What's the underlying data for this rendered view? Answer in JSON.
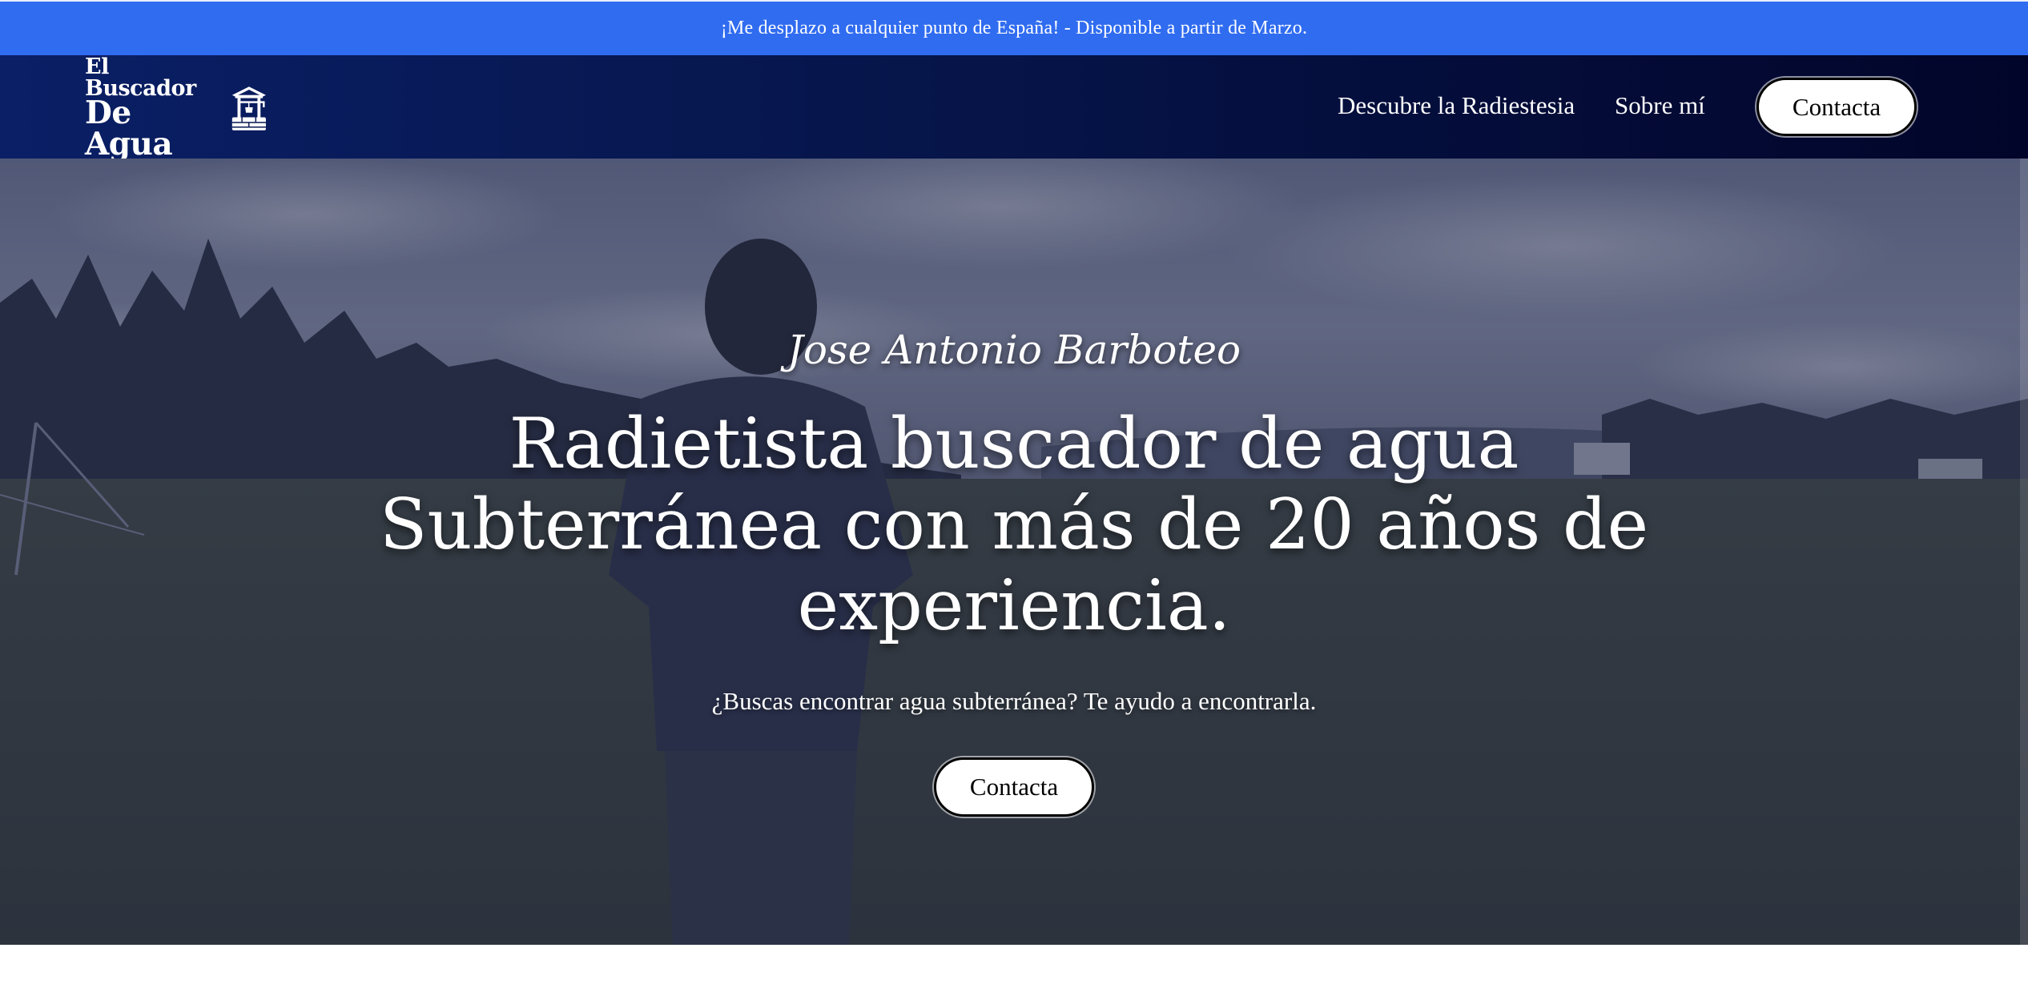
{
  "announcement": {
    "text": "¡Me desplazo a cualquier punto de España! - Disponible a partir de Marzo."
  },
  "header": {
    "logo": {
      "line1": "El Buscador",
      "line2": "De Agua"
    },
    "nav": [
      {
        "label": "Descubre la Radiestesia"
      },
      {
        "label": "Sobre mí"
      }
    ],
    "cta_label": "Contacta"
  },
  "hero": {
    "name": "Jose Antonio Barboteo",
    "title": "Radietista buscador de agua Subterránea con más de 20 años de experiencia.",
    "subtitle": "¿Buscas encontrar agua subterránea? Te ayudo a encontrarla.",
    "cta_label": "Contacta"
  },
  "colors": {
    "announcement_bg": "#306cf0",
    "header_bg_start": "#0a1f66",
    "header_bg_end": "#02052a",
    "button_bg": "#ffffff",
    "button_text": "#000000"
  },
  "icons": {
    "logo_mark": "water-well-icon"
  }
}
